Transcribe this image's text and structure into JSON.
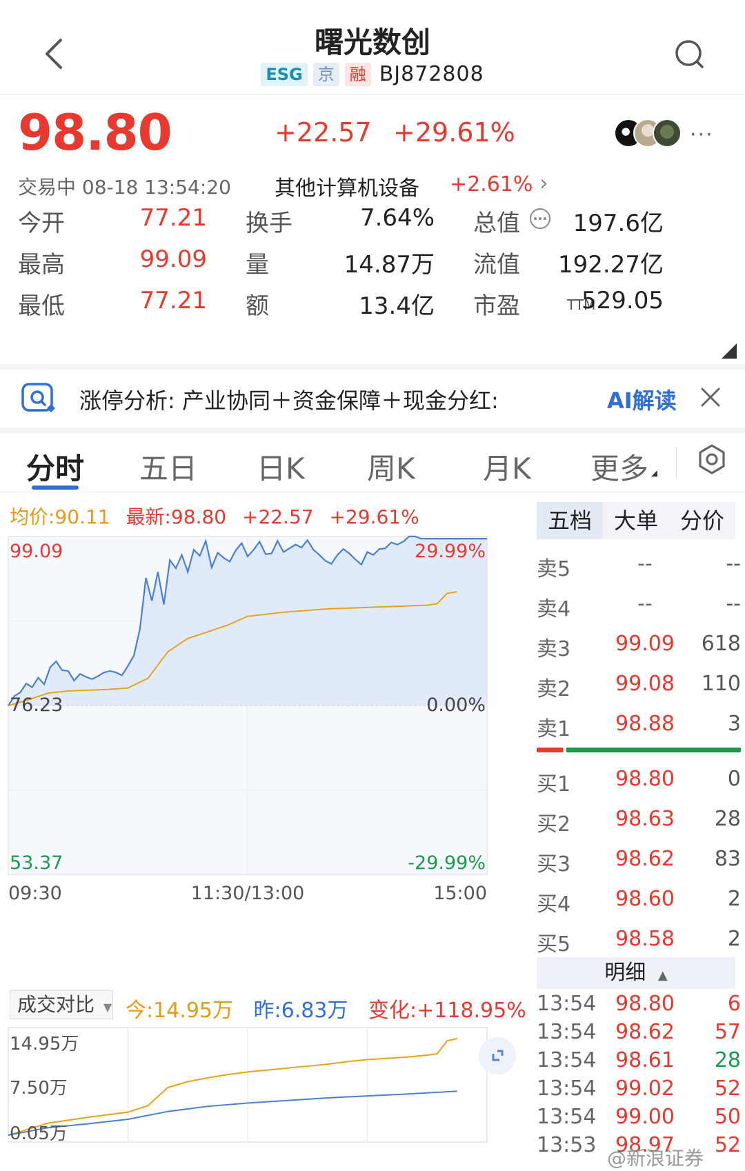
{
  "header": {
    "title": "曙光数创",
    "tags": [
      "ESG",
      "京",
      "融"
    ],
    "code": "BJ872808"
  },
  "quote": {
    "price": "98.80",
    "change": "+22.57",
    "change_pct": "+29.61%",
    "status": "交易中 08-18 13:54:20",
    "industry": "其他计算机设备",
    "industry_pct": "+2.61%",
    "more": "···",
    "stats": [
      {
        "label": "今开",
        "value": "77.21",
        "color": "red"
      },
      {
        "label": "换手",
        "value": "7.64%",
        "color": "dark"
      },
      {
        "label": "总值",
        "value": "197.6亿",
        "color": "dark"
      },
      {
        "label": "最高",
        "value": "99.09",
        "color": "red"
      },
      {
        "label": "量",
        "value": "14.87万",
        "color": "dark"
      },
      {
        "label": "流值",
        "value": "192.27亿",
        "color": "dark"
      },
      {
        "label": "最低",
        "value": "77.21",
        "color": "red"
      },
      {
        "label": "额",
        "value": "13.4亿",
        "color": "dark"
      },
      {
        "label": "市盈",
        "value": "529.05",
        "color": "dark"
      }
    ],
    "ttm": "TTM"
  },
  "banner": {
    "text": "涨停分析: 产业协同＋资金保障＋现金分红:",
    "ai_label": "AI解读"
  },
  "tabs": [
    "分时",
    "五日",
    "日K",
    "周K",
    "月K",
    "更多"
  ],
  "legend": {
    "avg": "均价:90.11",
    "latest": "最新:98.80",
    "change": "+22.57",
    "pct": "+29.61%"
  },
  "chart_data": [
    {
      "type": "line",
      "title": "",
      "x_ticks": [
        "09:30",
        "11:30/13:00",
        "15:00"
      ],
      "y_left_ticks": [
        "99.09",
        "76.23",
        "53.37"
      ],
      "y_right_ticks": [
        "29.99%",
        "0.00%",
        "-29.99%"
      ],
      "ylim": [
        53.37,
        99.09
      ],
      "prev_close": 76.23,
      "grid": true,
      "series": [
        {
          "name": "最新",
          "color": "#4a7fd4",
          "x": [
            0,
            3,
            6,
            9,
            12,
            15,
            18,
            21,
            24,
            27,
            30,
            33,
            36,
            39,
            42,
            45,
            48,
            51,
            54,
            57,
            60,
            63,
            66,
            69,
            72,
            75,
            78,
            81,
            84,
            87,
            90,
            93,
            96,
            99,
            102,
            105,
            108,
            111,
            114,
            117,
            120,
            123,
            126,
            129,
            132,
            135,
            138,
            141,
            144,
            147,
            150,
            153,
            156,
            159,
            162,
            165,
            168,
            171,
            174,
            177,
            180,
            183,
            186,
            189,
            192,
            195,
            198,
            201,
            204,
            207,
            210,
            213,
            216,
            219,
            222,
            225,
            228,
            231,
            234,
            237,
            240
          ],
          "values": [
            76.2,
            77.5,
            78.0,
            79.2,
            78.7,
            80.0,
            79.1,
            81.4,
            82.2,
            81.0,
            80.9,
            79.6,
            80.5,
            80.1,
            79.8,
            80.2,
            80.7,
            80.9,
            80.7,
            80.3,
            81.6,
            83.0,
            86.6,
            93.5,
            90.4,
            94.3,
            89.9,
            95.9,
            94.8,
            96.6,
            94.3,
            97.3,
            96.5,
            98.5,
            94.9,
            96.9,
            96.2,
            95.7,
            97.2,
            98.2,
            96.4,
            97.3,
            98.4,
            96.7,
            96.8,
            98.5,
            97.0,
            97.5,
            98.0,
            97.6,
            98.6,
            97.3,
            96.6,
            95.8,
            95.4,
            96.6,
            97.4,
            96.8,
            96.0,
            95.3,
            97.0,
            96.6,
            97.4,
            97.5,
            98.3,
            98.0,
            98.4,
            99.1,
            99.1,
            98.8,
            98.8,
            98.8,
            98.8,
            98.8,
            98.8,
            98.8,
            98.8,
            98.8,
            98.8,
            98.8,
            98.8
          ]
        },
        {
          "name": "均价",
          "color": "#e8a21a",
          "x": [
            0,
            10,
            20,
            30,
            40,
            50,
            60,
            70,
            80,
            90,
            100,
            110,
            120,
            130,
            140,
            150,
            160,
            170,
            180,
            190,
            200,
            210,
            215,
            220,
            225
          ],
          "values": [
            76.2,
            77.0,
            77.9,
            78.2,
            78.3,
            78.4,
            78.6,
            79.9,
            83.5,
            85.3,
            86.2,
            87.1,
            88.3,
            88.6,
            88.9,
            89.1,
            89.3,
            89.4,
            89.5,
            89.6,
            89.7,
            89.8,
            90.0,
            91.4,
            91.6
          ]
        }
      ]
    },
    {
      "type": "line",
      "title": "成交对比",
      "y_ticks": [
        "14.95万",
        "7.50万",
        "0.05万"
      ],
      "ylim": [
        0.05,
        14.95
      ],
      "grid": true,
      "series": [
        {
          "name": "今:14.95万",
          "color": "#e8a21a",
          "x": [
            0,
            20,
            40,
            60,
            70,
            80,
            90,
            100,
            110,
            120,
            130,
            140,
            150,
            160,
            170,
            180,
            190,
            200,
            210,
            215,
            220,
            225
          ],
          "values": [
            0.05,
            1.9,
            2.8,
            3.6,
            4.6,
            7.4,
            8.3,
            8.9,
            9.4,
            9.8,
            10.1,
            10.4,
            10.7,
            11.0,
            11.4,
            11.7,
            11.9,
            12.1,
            12.4,
            12.6,
            14.6,
            14.95
          ]
        },
        {
          "name": "昨:6.83万",
          "color": "#4a7fd4",
          "x": [
            0,
            20,
            40,
            60,
            80,
            100,
            120,
            140,
            160,
            180,
            200,
            225
          ],
          "values": [
            0.05,
            1.2,
            1.8,
            2.5,
            3.7,
            4.5,
            5.0,
            5.4,
            5.8,
            6.1,
            6.4,
            6.83
          ]
        }
      ]
    }
  ],
  "vol": {
    "dropdown": "成交对比",
    "today": "今:14.95万",
    "yesterday": "昨:6.83万",
    "change": "变化:+118.95%"
  },
  "order_book": {
    "tabs": [
      "五档",
      "大单",
      "分价"
    ],
    "sells": [
      {
        "label": "卖5",
        "price": "--",
        "vol": "--"
      },
      {
        "label": "卖4",
        "price": "--",
        "vol": "--"
      },
      {
        "label": "卖3",
        "price": "99.09",
        "vol": "618"
      },
      {
        "label": "卖2",
        "price": "99.08",
        "vol": "110"
      },
      {
        "label": "卖1",
        "price": "98.88",
        "vol": "3"
      }
    ],
    "buys": [
      {
        "label": "买1",
        "price": "98.80",
        "vol": "0"
      },
      {
        "label": "买2",
        "price": "98.63",
        "vol": "28"
      },
      {
        "label": "买3",
        "price": "98.62",
        "vol": "83"
      },
      {
        "label": "买4",
        "price": "98.60",
        "vol": "2"
      },
      {
        "label": "买5",
        "price": "98.58",
        "vol": "2"
      }
    ],
    "bid_share": 0.11
  },
  "detail": {
    "header": "明细",
    "ticks": [
      {
        "time": "13:54",
        "price": "98.80",
        "vol": "6",
        "dir": "up"
      },
      {
        "time": "13:54",
        "price": "98.62",
        "vol": "57",
        "dir": "up"
      },
      {
        "time": "13:54",
        "price": "98.61",
        "vol": "28",
        "dir": "down"
      },
      {
        "time": "13:54",
        "price": "99.02",
        "vol": "52",
        "dir": "up"
      },
      {
        "time": "13:54",
        "price": "99.00",
        "vol": "50",
        "dir": "up"
      },
      {
        "time": "13:53",
        "price": "98.97",
        "vol": "52",
        "dir": "up"
      }
    ]
  },
  "watermark": "@新浪证券",
  "colors": {
    "up": "#e8392f",
    "down": "#1a9b4a",
    "accent": "#2f6fd6",
    "avg_line": "#e8a21a",
    "price_line": "#4a7fd4"
  }
}
